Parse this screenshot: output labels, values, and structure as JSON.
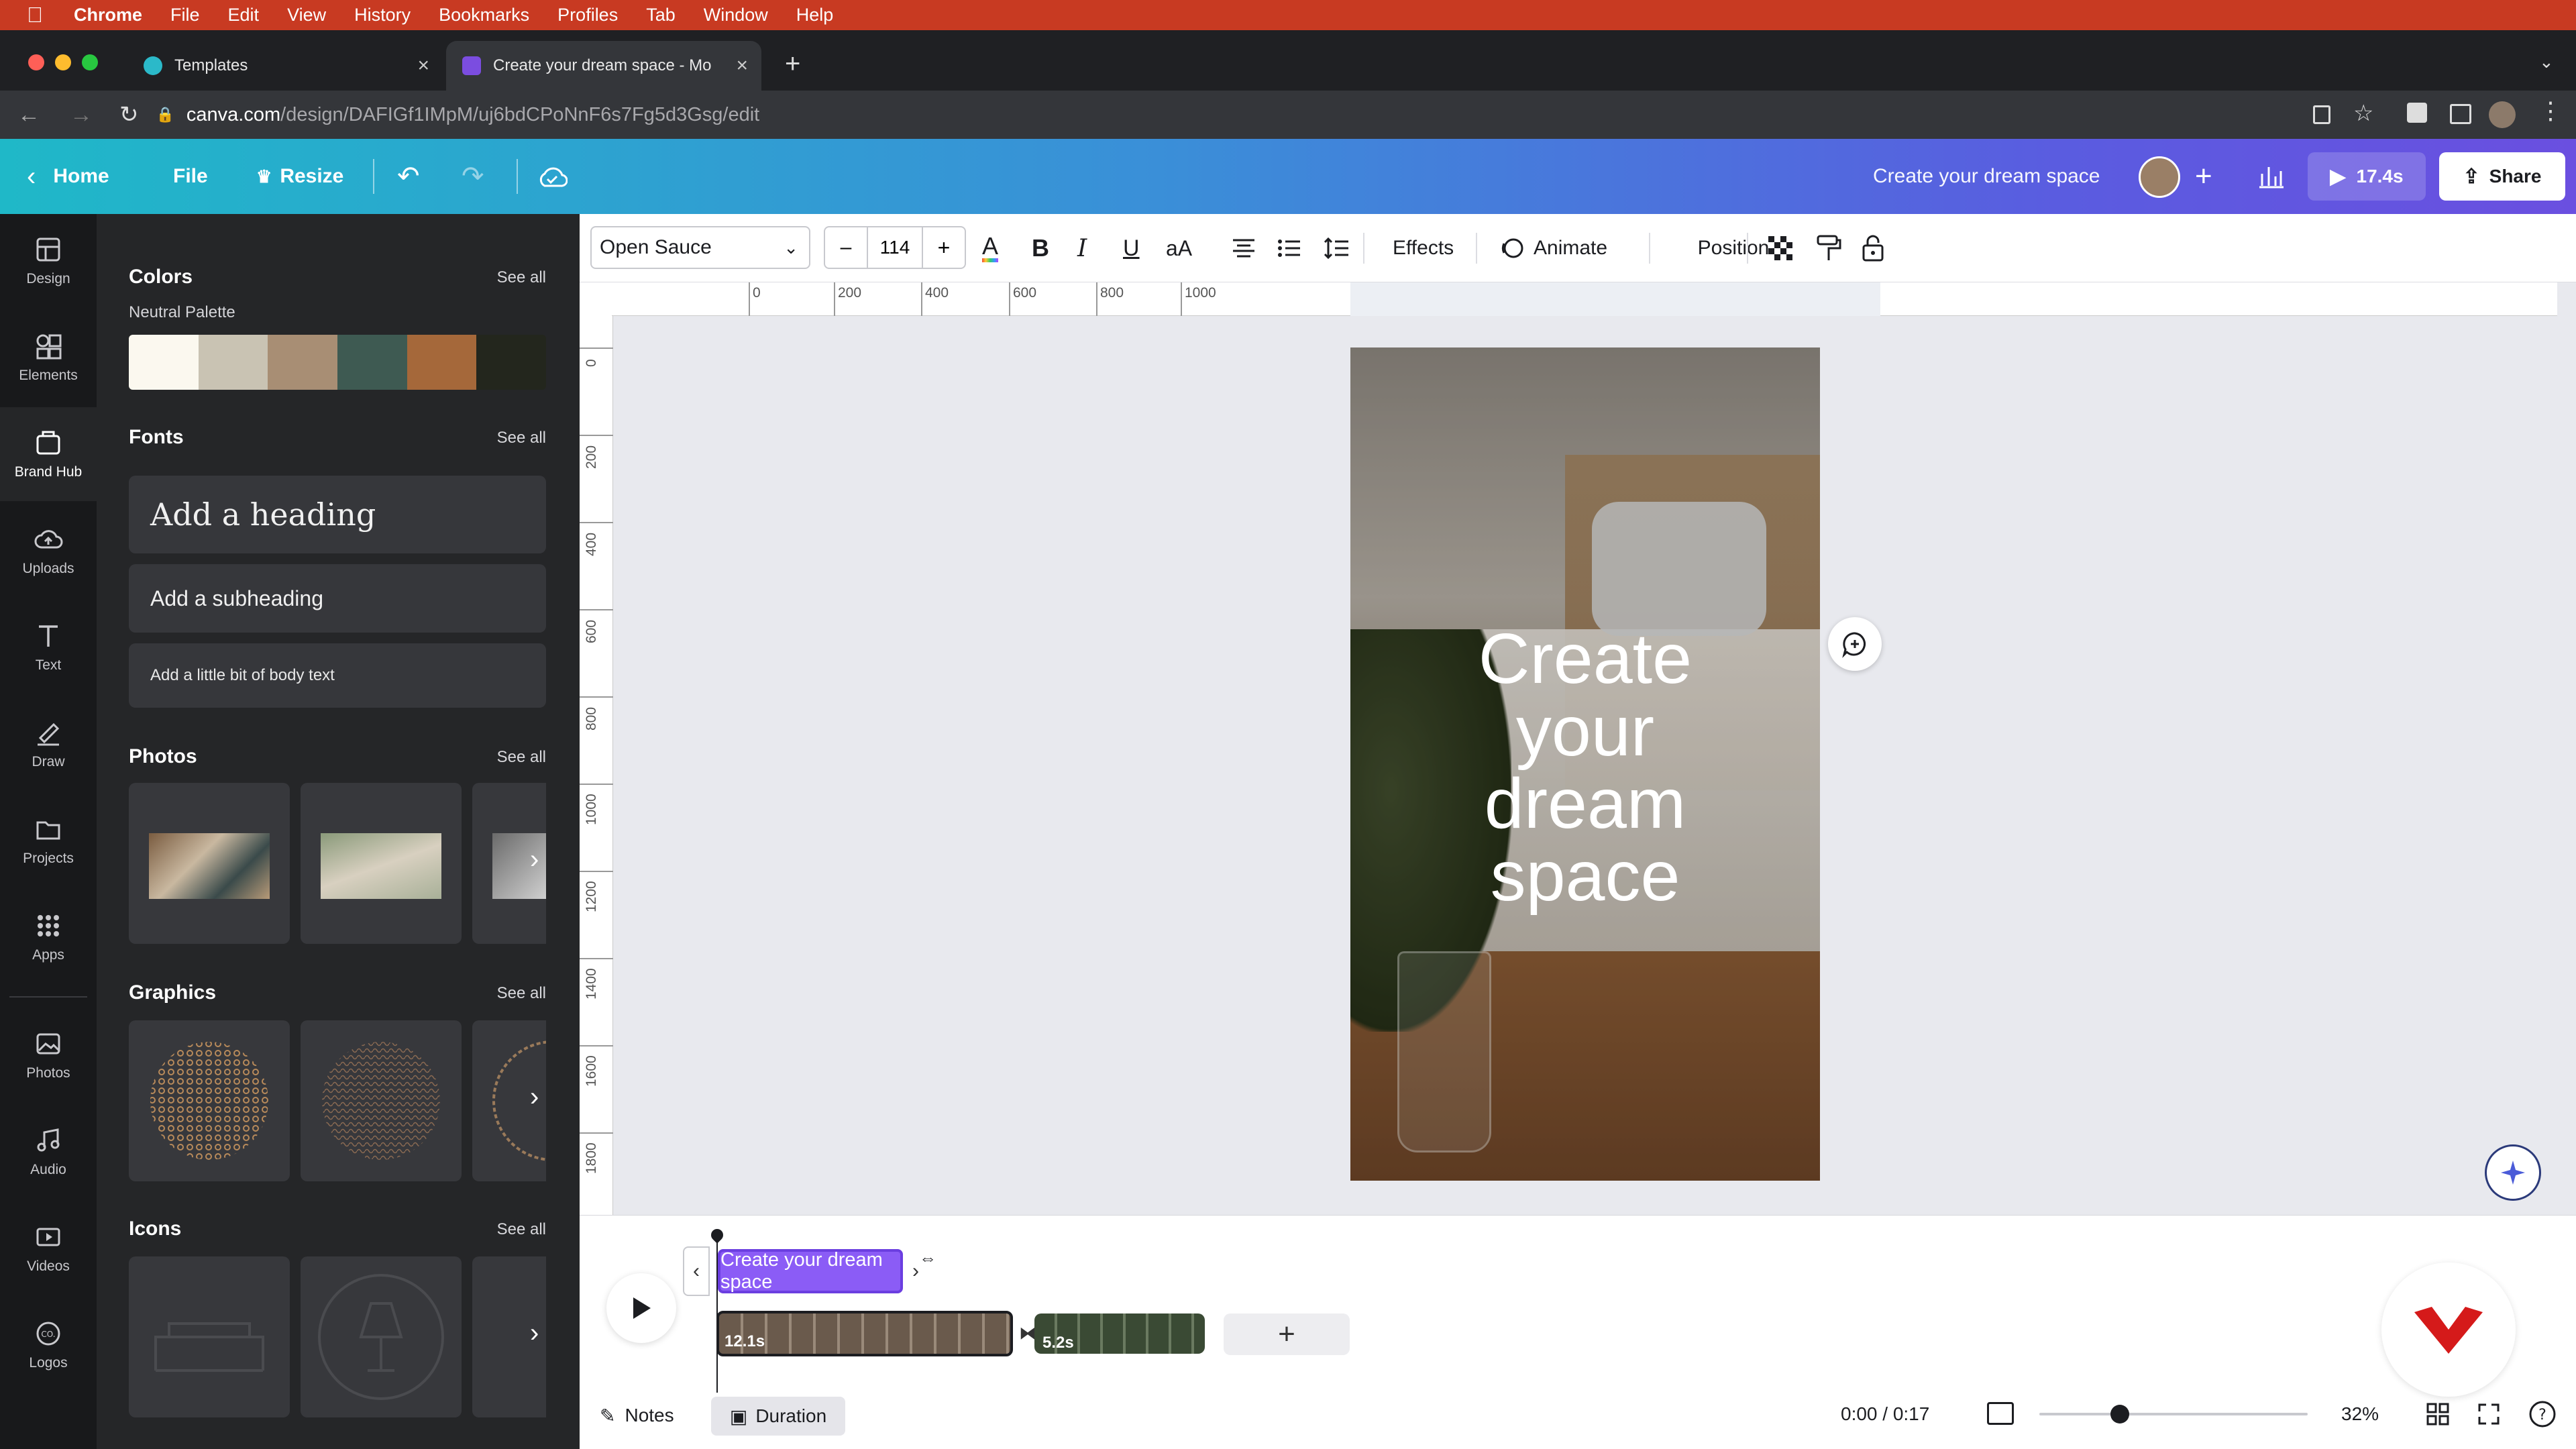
{
  "mac_menu": {
    "apple": "",
    "items": [
      "Chrome",
      "File",
      "Edit",
      "View",
      "History",
      "Bookmarks",
      "Profiles",
      "Tab",
      "Window",
      "Help"
    ]
  },
  "browser": {
    "tabs": [
      {
        "title": "Templates"
      },
      {
        "title": "Create your dream space - Mo"
      }
    ],
    "url_domain": "canva.com",
    "url_path": "/design/DAFIGf1IMpM/uj6bdCPoNnF6s7Fg5d3Gsg/edit"
  },
  "header": {
    "home": "Home",
    "file": "File",
    "resize": "Resize",
    "design_title": "Create your dream space",
    "play_duration": "17.4s",
    "share": "Share"
  },
  "rail": [
    "Design",
    "Elements",
    "Brand Hub",
    "Uploads",
    "Text",
    "Draw",
    "Projects",
    "Apps",
    "Photos",
    "Audio",
    "Videos",
    "Logos"
  ],
  "panel": {
    "colors": {
      "title": "Colors",
      "see_all": "See all",
      "palette_name": "Neutral Palette",
      "swatches": [
        "#fbf8ef",
        "#c9c3b3",
        "#a88e74",
        "#3e5a52",
        "#a5683a",
        "#23261d"
      ]
    },
    "fonts": {
      "title": "Fonts",
      "see_all": "See all",
      "heading": "Add a heading",
      "subheading": "Add a subheading",
      "body": "Add a little bit of body text"
    },
    "photos": {
      "title": "Photos",
      "see_all": "See all"
    },
    "graphics": {
      "title": "Graphics",
      "see_all": "See all"
    },
    "icons": {
      "title": "Icons",
      "see_all": "See all"
    }
  },
  "toolbar": {
    "font": "Open Sauce",
    "size": "114",
    "minus": "–",
    "plus": "+",
    "effects": "Effects",
    "animate": "Animate",
    "position": "Position"
  },
  "ruler": {
    "h": [
      "0",
      "200",
      "400",
      "600",
      "800",
      "1000"
    ],
    "v": [
      "0",
      "200",
      "400",
      "600",
      "800",
      "1000",
      "1200",
      "1400",
      "1600",
      "1800"
    ]
  },
  "canvas": {
    "line1": "Create",
    "line2": "your",
    "line3": "dream",
    "line4": "space"
  },
  "timeline": {
    "clip_label": "Create your dream space",
    "scene1_duration": "12.1s",
    "scene2_duration": "5.2s",
    "notes": "Notes",
    "duration": "Duration",
    "time": "0:00 / 0:17",
    "zoom": "32%",
    "zoom_level": 0.3
  }
}
